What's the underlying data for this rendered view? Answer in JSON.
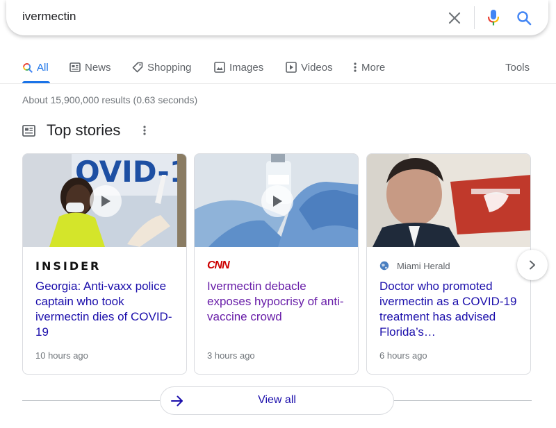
{
  "search": {
    "query": "ivermectin"
  },
  "tabs": [
    {
      "label": "All",
      "icon": "search-icon"
    },
    {
      "label": "News",
      "icon": "news-icon"
    },
    {
      "label": "Shopping",
      "icon": "tag-icon"
    },
    {
      "label": "Images",
      "icon": "image-icon"
    },
    {
      "label": "Videos",
      "icon": "play-icon"
    },
    {
      "label": "More",
      "icon": "more-vert-icon"
    }
  ],
  "tools_label": "Tools",
  "result_stats": "About 15,900,000 results (0.63 seconds)",
  "top_stories": {
    "title": "Top stories",
    "cards": [
      {
        "source": "INSIDER",
        "headline": "Georgia: Anti-vaxx police captain who took ivermectin dies of COVID-19",
        "time": "10 hours ago",
        "thumb_text": "OVID-1",
        "has_video": true
      },
      {
        "source": "CNN",
        "headline": "Ivermectin debacle exposes hypocrisy of anti-vaccine crowd",
        "time": "3 hours ago",
        "has_video": true
      },
      {
        "source": "Miami Herald",
        "headline": "Doctor who promoted ivermectin as a COVID-19 treatment has advised Florida’s…",
        "time": "6 hours ago",
        "has_video": false
      }
    ]
  },
  "view_all_label": "View all",
  "colors": {
    "accent": "#1a73e8",
    "link": "#1a0dab",
    "visited": "#681da8",
    "cnn_red": "#cc0000"
  }
}
